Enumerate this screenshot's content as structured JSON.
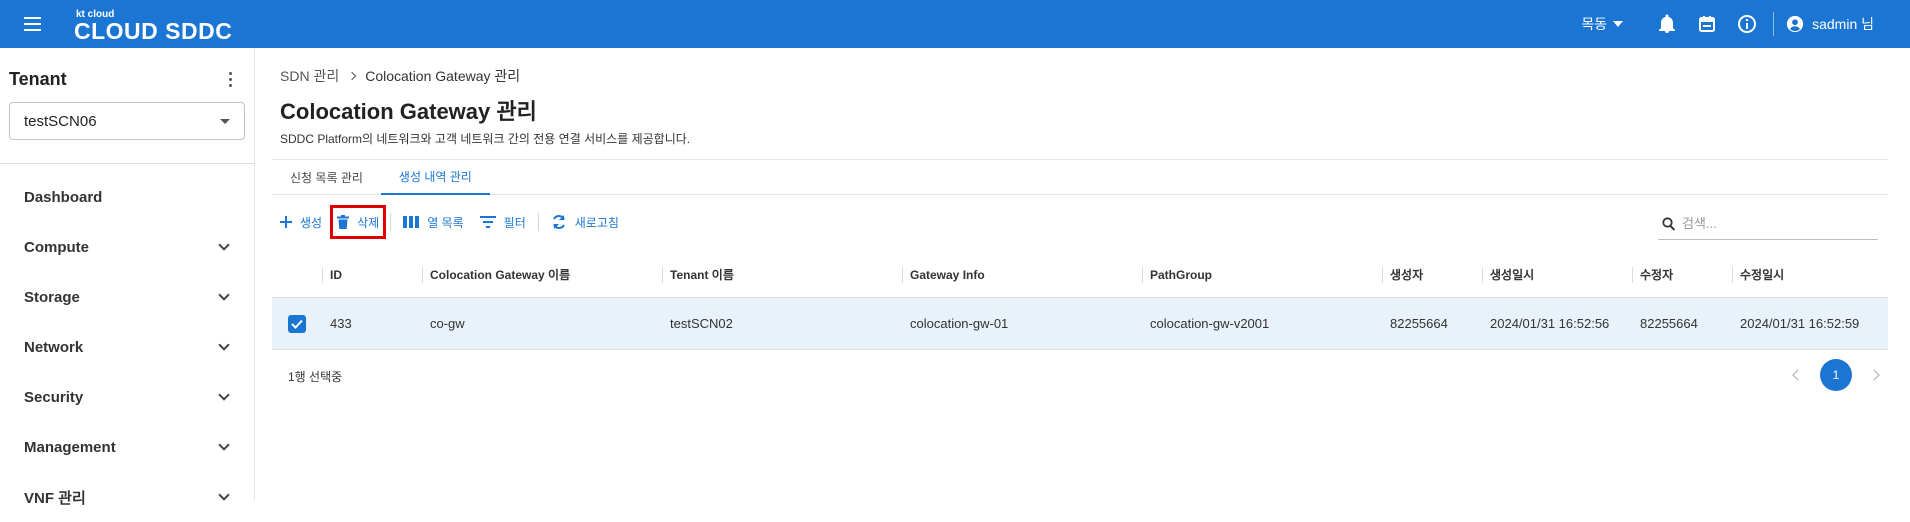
{
  "header": {
    "logo_small": "kt cloud",
    "logo_main": "CLOUD SDDC",
    "language": "목동",
    "user_name": "sadmin 님",
    "icons": [
      "menu-icon",
      "bell-icon",
      "calendar-icon",
      "info-icon",
      "account-circle-icon"
    ]
  },
  "sidebar": {
    "tenant_label": "Tenant",
    "tenant_value": "testSCN06",
    "items": [
      {
        "label": "Dashboard"
      },
      {
        "label": "Compute"
      },
      {
        "label": "Storage"
      },
      {
        "label": "Network"
      },
      {
        "label": "Security"
      },
      {
        "label": "Management"
      },
      {
        "label": "VNF 관리"
      }
    ]
  },
  "main": {
    "breadcrumb": [
      "SDN 관리",
      "Colocation Gateway 관리"
    ],
    "title": "Colocation Gateway 관리",
    "description": "SDDC Platform의 네트워크와 고객 네트워크 간의 전용 연결 서비스를 제공합니다.",
    "tabs": [
      {
        "label": "신청 목록 관리",
        "active": false
      },
      {
        "label": "생성 내역 관리",
        "active": true
      }
    ],
    "toolbar": {
      "create": "생성",
      "delete": "삭제",
      "columns": "열 목록",
      "filter": "필터",
      "refresh": "새로고침"
    },
    "search": {
      "placeholder": "검색..."
    },
    "table": {
      "headers": [
        "ID",
        "Colocation Gateway 이름",
        "Tenant 이름",
        "Gateway Info",
        "PathGroup",
        "생성자",
        "생성일시",
        "수정자",
        "수정일시"
      ],
      "rows": [
        {
          "selected": true,
          "cells": [
            "433",
            "co-gw",
            "testSCN02",
            "colocation-gw-01",
            "colocation-gw-v2001",
            "82255664",
            "2024/01/31 16:52:56",
            "82255664",
            "2024/01/31 16:52:59"
          ]
        }
      ]
    },
    "selection_text": "1행 선택중",
    "pagination": {
      "current": "1"
    }
  },
  "colors": {
    "primary": "#1a76d2",
    "highlight_border": "#e00000",
    "selected_row": "#e9f1fb"
  }
}
